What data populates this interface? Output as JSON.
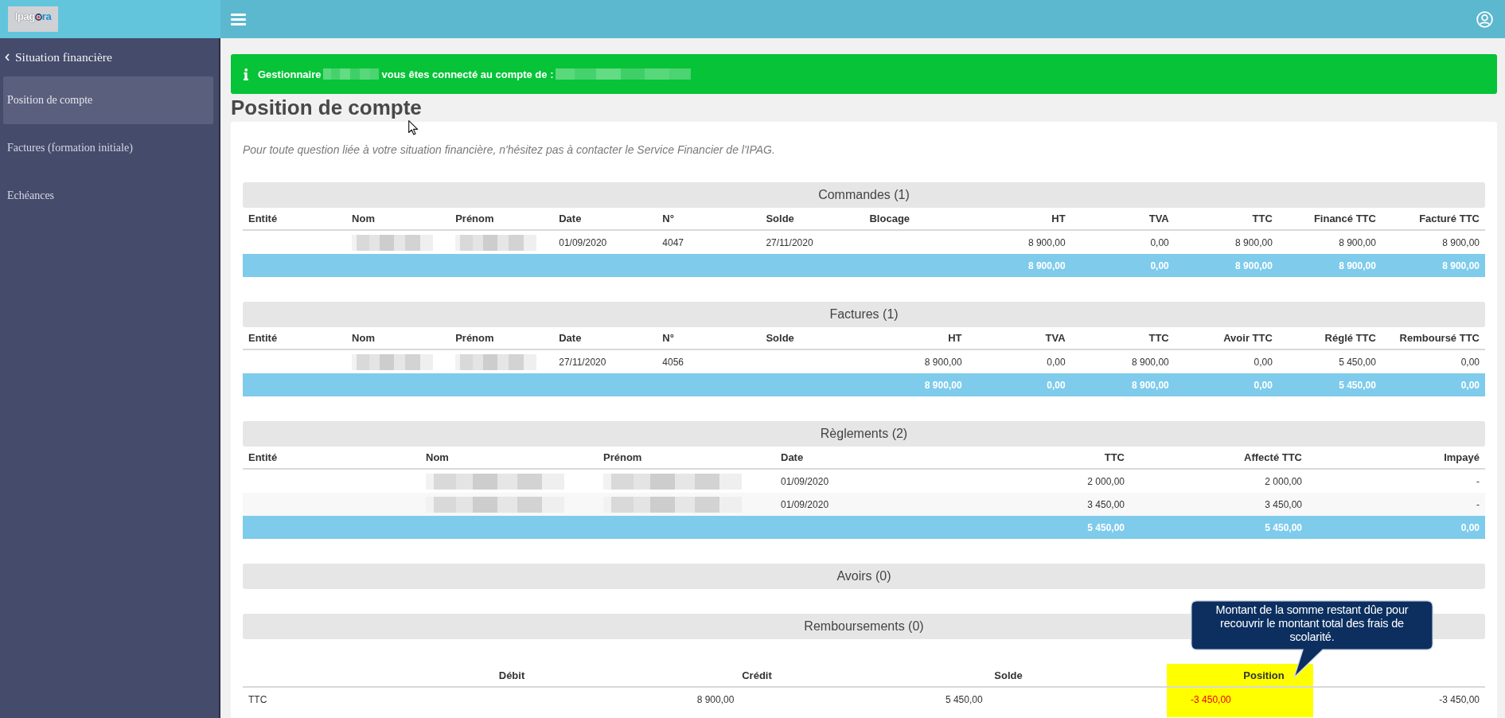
{
  "topbar": {
    "logo": {
      "prefix": "Ipag",
      "suffix": "ra"
    }
  },
  "sidebar": {
    "back_label": "Situation financière",
    "items": [
      {
        "label": "Position de compte",
        "selected": true
      },
      {
        "label": "Factures (formation initiale)",
        "selected": false
      },
      {
        "label": "Echéances",
        "selected": false
      }
    ]
  },
  "banner": {
    "segments": [
      {
        "kind": "text",
        "text": "Gestionnaire"
      },
      {
        "kind": "redacted"
      },
      {
        "kind": "text",
        "text": "vous êtes connecté au compte de :"
      },
      {
        "kind": "redacted"
      }
    ]
  },
  "page": {
    "title": "Position de compte",
    "intro": "Pour toute question liée à votre situation financière, n'hésitez pas à contacter le Service Financier de l'IPAG."
  },
  "sections": [
    {
      "title": "Commandes (1)",
      "columns": [
        {
          "label": "Entité",
          "kind": "text"
        },
        {
          "label": "Nom",
          "kind": "text",
          "cells": [
            {
              "kind": "redacted"
            }
          ]
        },
        {
          "label": "Prénom",
          "kind": "text",
          "cells": [
            {
              "kind": "redacted"
            }
          ]
        },
        {
          "label": "Date",
          "kind": "text",
          "cells": [
            "01/09/2020"
          ]
        },
        {
          "label": "N°",
          "kind": "text",
          "cells": [
            "4047"
          ]
        },
        {
          "label": "Solde",
          "kind": "text",
          "cells": [
            "27/11/2020"
          ]
        },
        {
          "label": "Blocage",
          "kind": "text"
        },
        {
          "label": "HT",
          "kind": "amount",
          "cells": [
            "8 900,00"
          ],
          "total": "8 900,00"
        },
        {
          "label": "TVA",
          "kind": "amount",
          "cells": [
            "0,00"
          ],
          "total": "0,00"
        },
        {
          "label": "TTC",
          "kind": "amount",
          "cells": [
            "8 900,00"
          ],
          "total": "8 900,00"
        },
        {
          "label": "Financé TTC",
          "kind": "amount",
          "cells": [
            "8 900,00"
          ],
          "total": "8 900,00"
        },
        {
          "label": "Facturé TTC",
          "kind": "amount",
          "cells": [
            "8 900,00"
          ],
          "total": "8 900,00"
        }
      ]
    },
    {
      "title": "Factures (1)",
      "columns": [
        {
          "label": "Entité",
          "kind": "text"
        },
        {
          "label": "Nom",
          "kind": "text",
          "cells": [
            {
              "kind": "redacted"
            }
          ]
        },
        {
          "label": "Prénom",
          "kind": "text",
          "cells": [
            {
              "kind": "redacted"
            }
          ]
        },
        {
          "label": "Date",
          "kind": "text",
          "cells": [
            "27/11/2020"
          ]
        },
        {
          "label": "N°",
          "kind": "text",
          "cells": [
            "4056"
          ]
        },
        {
          "label": "Solde",
          "kind": "text"
        },
        {
          "label": "HT",
          "kind": "amount",
          "cells": [
            "8 900,00"
          ],
          "total": "8 900,00"
        },
        {
          "label": "TVA",
          "kind": "amount",
          "cells": [
            "0,00"
          ],
          "total": "0,00"
        },
        {
          "label": "TTC",
          "kind": "amount",
          "cells": [
            "8 900,00"
          ],
          "total": "8 900,00"
        },
        {
          "label": "Avoir TTC",
          "kind": "amount",
          "cells": [
            "0,00"
          ],
          "total": "0,00"
        },
        {
          "label": "Réglé TTC",
          "kind": "amount",
          "cells": [
            "5 450,00"
          ],
          "total": "5 450,00"
        },
        {
          "label": "Remboursé TTC",
          "kind": "amount",
          "cells": [
            "0,00"
          ],
          "total": "0,00"
        }
      ]
    },
    {
      "title": "Règlements (2)",
      "columns": [
        {
          "label": "Entité",
          "kind": "text"
        },
        {
          "label": "Nom",
          "kind": "text",
          "cells": [
            {
              "kind": "redacted"
            },
            {
              "kind": "redacted"
            }
          ]
        },
        {
          "label": "Prénom",
          "kind": "text",
          "cells": [
            {
              "kind": "redacted"
            },
            {
              "kind": "redacted"
            }
          ]
        },
        {
          "label": "Date",
          "kind": "text",
          "cells": [
            "01/09/2020",
            "01/09/2020"
          ]
        },
        {
          "label": "TTC",
          "kind": "amount",
          "cells": [
            "2 000,00",
            "3 450,00"
          ],
          "total": "5 450,00"
        },
        {
          "label": "Affecté TTC",
          "kind": "amount",
          "cells": [
            "2 000,00",
            "3 450,00"
          ],
          "total": "5 450,00"
        },
        {
          "label": "Impayé",
          "kind": "amount",
          "cells": [
            "-",
            "-"
          ],
          "total": "0,00"
        }
      ]
    },
    {
      "title": "Avoirs (0)"
    },
    {
      "title": "Remboursements (0)"
    }
  ],
  "balance": {
    "columns": [
      {
        "label": "Débit",
        "highlighted": false
      },
      {
        "label": "Crédit",
        "highlighted": false
      },
      {
        "label": "Solde",
        "highlighted": false
      },
      {
        "label": "Position",
        "highlighted": true
      }
    ],
    "rows": [
      {
        "label": "TTC",
        "values": [
          {
            "text": "8 900,00",
            "alert": false
          },
          {
            "text": "5 450,00",
            "alert": false
          },
          {
            "text": "-3 450,00",
            "alert": true
          },
          {
            "text": "-3 450,00",
            "alert": false
          }
        ]
      }
    ]
  },
  "callout": {
    "text": "Montant de la somme restant dûe pour recouvrir le montant total des frais de scolarité."
  }
}
